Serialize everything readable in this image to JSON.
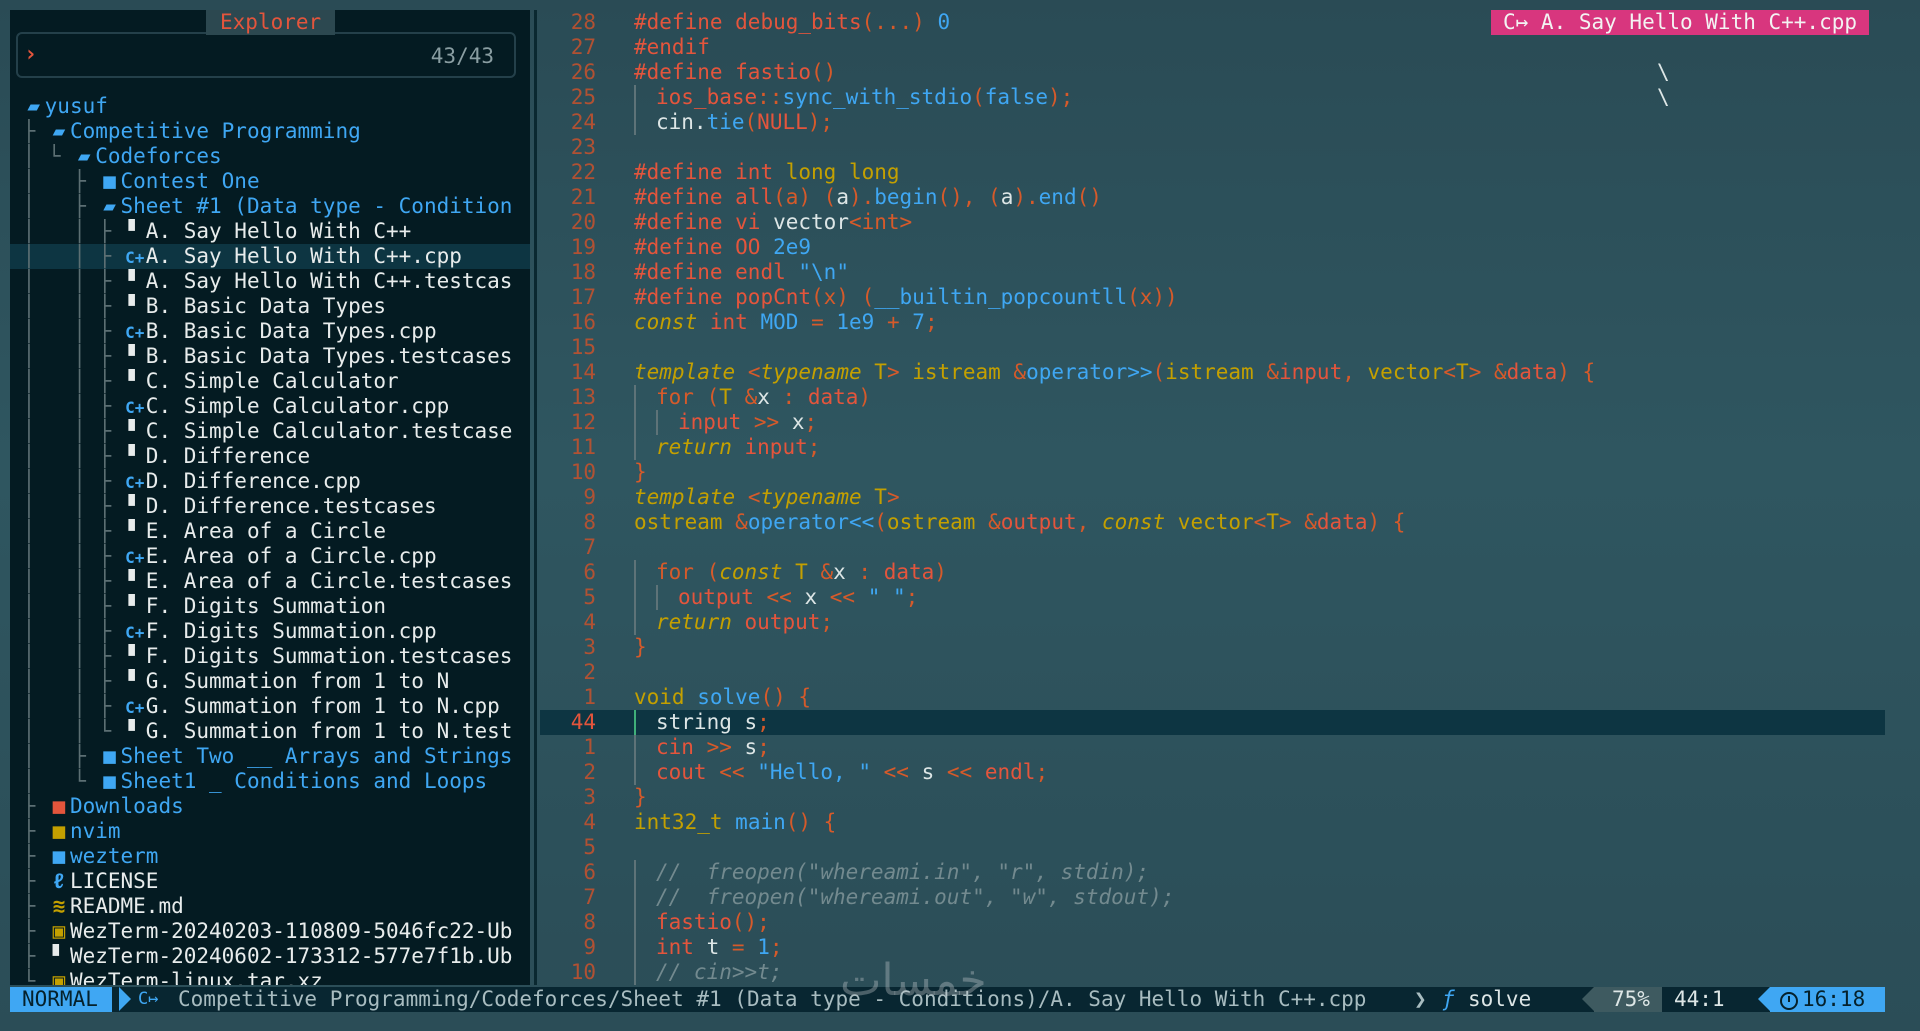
{
  "explorer": {
    "title": "Explorer",
    "prompt": "›",
    "count": "43/43",
    "items": [
      {
        "guides": " ",
        "icon": "folder-open-icon",
        "glyph": "▰",
        "kind": "dir",
        "label": "yusuf"
      },
      {
        "guides": " ├ ",
        "icon": "folder-open-icon",
        "glyph": "▰",
        "kind": "dir",
        "label": "Competitive Programming"
      },
      {
        "guides": " │ └ ",
        "icon": "folder-open-icon",
        "glyph": "▰",
        "kind": "dir",
        "label": "Codeforces"
      },
      {
        "guides": " │   ├ ",
        "icon": "folder-icon",
        "glyph": "■",
        "kind": "dir",
        "label": "Contest One"
      },
      {
        "guides": " │   ├ ",
        "icon": "folder-open-icon",
        "glyph": "▰",
        "kind": "dir",
        "label": "Sheet #1 (Data type - Condition"
      },
      {
        "guides": " │   │ ├ ",
        "icon": "file-icon",
        "glyph": "▘",
        "kind": "plain",
        "label": "A. Say Hello With C++"
      },
      {
        "guides": " │   │ ├ ",
        "icon": "cpp-icon",
        "glyph": "C+",
        "kind": "cpp",
        "label": "A. Say Hello With C++.cpp",
        "selected": true
      },
      {
        "guides": " │   │ ├ ",
        "icon": "file-icon",
        "glyph": "▘",
        "kind": "plain",
        "label": "A. Say Hello With C++.testcas"
      },
      {
        "guides": " │   │ ├ ",
        "icon": "file-icon",
        "glyph": "▘",
        "kind": "plain",
        "label": "B. Basic Data Types"
      },
      {
        "guides": " │   │ ├ ",
        "icon": "cpp-icon",
        "glyph": "C+",
        "kind": "cpp",
        "label": "B. Basic Data Types.cpp"
      },
      {
        "guides": " │   │ ├ ",
        "icon": "file-icon",
        "glyph": "▘",
        "kind": "plain",
        "label": "B. Basic Data Types.testcases"
      },
      {
        "guides": " │   │ ├ ",
        "icon": "file-icon",
        "glyph": "▘",
        "kind": "plain",
        "label": "C. Simple Calculator"
      },
      {
        "guides": " │   │ ├ ",
        "icon": "cpp-icon",
        "glyph": "C+",
        "kind": "cpp",
        "label": "C. Simple Calculator.cpp"
      },
      {
        "guides": " │   │ ├ ",
        "icon": "file-icon",
        "glyph": "▘",
        "kind": "plain",
        "label": "C. Simple Calculator.testcase"
      },
      {
        "guides": " │   │ ├ ",
        "icon": "file-icon",
        "glyph": "▘",
        "kind": "plain",
        "label": "D.  Difference"
      },
      {
        "guides": " │   │ ├ ",
        "icon": "cpp-icon",
        "glyph": "C+",
        "kind": "cpp",
        "label": "D.  Difference.cpp"
      },
      {
        "guides": " │   │ ├ ",
        "icon": "file-icon",
        "glyph": "▘",
        "kind": "plain",
        "label": "D.  Difference.testcases"
      },
      {
        "guides": " │   │ ├ ",
        "icon": "file-icon",
        "glyph": "▘",
        "kind": "plain",
        "label": "E. Area of a Circle"
      },
      {
        "guides": " │   │ ├ ",
        "icon": "cpp-icon",
        "glyph": "C+",
        "kind": "cpp",
        "label": "E. Area of a Circle.cpp"
      },
      {
        "guides": " │   │ ├ ",
        "icon": "file-icon",
        "glyph": "▘",
        "kind": "plain",
        "label": "E. Area of a Circle.testcases"
      },
      {
        "guides": " │   │ ├ ",
        "icon": "file-icon",
        "glyph": "▘",
        "kind": "plain",
        "label": "F. Digits Summation"
      },
      {
        "guides": " │   │ ├ ",
        "icon": "cpp-icon",
        "glyph": "C+",
        "kind": "cpp",
        "label": "F. Digits Summation.cpp"
      },
      {
        "guides": " │   │ ├ ",
        "icon": "file-icon",
        "glyph": "▘",
        "kind": "plain",
        "label": "F. Digits Summation.testcases"
      },
      {
        "guides": " │   │ ├ ",
        "icon": "file-icon",
        "glyph": "▘",
        "kind": "plain",
        "label": "G. Summation from 1 to N"
      },
      {
        "guides": " │   │ ├ ",
        "icon": "cpp-icon",
        "glyph": "C+",
        "kind": "cpp",
        "label": "G. Summation from 1 to N.cpp"
      },
      {
        "guides": " │   │ └ ",
        "icon": "file-icon",
        "glyph": "▘",
        "kind": "plain",
        "label": "G. Summation from 1 to N.test"
      },
      {
        "guides": " │   ├ ",
        "icon": "folder-icon",
        "glyph": "■",
        "kind": "dir",
        "label": "Sheet Two __ Arrays and Strings"
      },
      {
        "guides": " │   └ ",
        "icon": "folder-icon",
        "glyph": "■",
        "kind": "dir",
        "label": "Sheet1 _ Conditions and Loops"
      },
      {
        "guides": " ├ ",
        "icon": "downloads-folder-icon",
        "glyph": "■",
        "kind": "dir",
        "label": "Downloads",
        "iconClass": "dl"
      },
      {
        "guides": " ├ ",
        "icon": "nvim-folder-icon",
        "glyph": "■",
        "kind": "dir",
        "label": "nvim",
        "iconClass": "yellow"
      },
      {
        "guides": " ├ ",
        "icon": "folder-icon",
        "glyph": "■",
        "kind": "dir",
        "label": "wezterm"
      },
      {
        "guides": " ├ ",
        "icon": "license-icon",
        "glyph": "ℓ",
        "kind": "plain",
        "label": "LICENSE",
        "iconClass": "lic"
      },
      {
        "guides": " ├ ",
        "icon": "markdown-icon",
        "glyph": "≋",
        "kind": "plain",
        "label": "README.md",
        "iconClass": "yellow"
      },
      {
        "guides": " ├ ",
        "icon": "archive-icon",
        "glyph": "▣",
        "kind": "plain",
        "label": "WezTerm-20240203-110809-5046fc22-Ub",
        "iconClass": "yellow"
      },
      {
        "guides": " ├ ",
        "icon": "file-icon",
        "glyph": "▘",
        "kind": "plain",
        "label": "WezTerm-20240602-173312-577e7f1b.Ub"
      },
      {
        "guides": " └ ",
        "icon": "archive-icon",
        "glyph": "▣",
        "kind": "plain",
        "label": "WezTerm-linux.tar.xz",
        "iconClass": "yellow"
      }
    ]
  },
  "editor": {
    "file_tag": "A. Say Hello With C++.cpp",
    "file_tag_icon": "cpp-icon",
    "line_numbers": [
      "28",
      "27",
      "26",
      "25",
      "24",
      "23",
      "22",
      "21",
      "20",
      "19",
      "18",
      "17",
      "16",
      "15",
      "14",
      "13",
      "12",
      "11",
      "10",
      "9",
      "8",
      "7",
      "6",
      "5",
      "4",
      "3",
      "2",
      "1",
      "44",
      "1",
      "2",
      "3",
      "4",
      "5",
      "6",
      "7",
      "8",
      "9",
      "10"
    ],
    "current_line_index": 28,
    "backslashes": [
      "\\",
      "\\"
    ]
  },
  "statusline": {
    "mode": "NORMAL",
    "path": "Competitive Programming/Codeforces/Sheet #1 (Data type - Conditions)/A. Say Hello With C++.cpp",
    "separator": "❯",
    "func_icon": "ƒ",
    "func": "solve",
    "percent": "75%",
    "position": "44:1",
    "time": "16:18"
  },
  "watermark": "خمسات",
  "colors": {
    "accent_blue": "#3fa7f3",
    "accent_red": "#e4553c",
    "accent_yellow": "#c4a000",
    "tag_pink": "#d8367e",
    "panel_bg": "#041b22"
  }
}
